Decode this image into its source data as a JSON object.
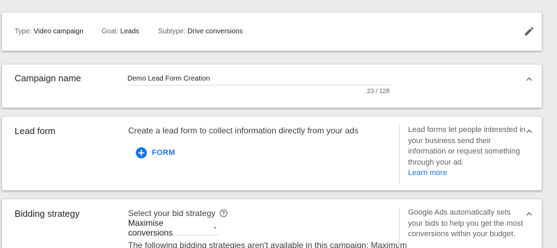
{
  "summary": {
    "type_label": "Type:",
    "type_value": "Video campaign",
    "goal_label": "Goal:",
    "goal_value": "Leads",
    "subtype_label": "Subtype:",
    "subtype_value": "Drive conversions",
    "edit_icon": "pencil-icon"
  },
  "campaign_name": {
    "title": "Campaign name",
    "value": "Demo Lead Form Creation",
    "counter": "23 / 128",
    "collapse_icon": "chevron-up-icon"
  },
  "lead_form": {
    "title": "Lead form",
    "description": "Create a lead form to collect information directly from your ads",
    "add_button": "FORM",
    "help_text": "Lead forms let people interested in your business send their information or request something through your ad.",
    "learn_more": "Learn more",
    "collapse_icon": "chevron-up-icon"
  },
  "bidding": {
    "title": "Bidding strategy",
    "prompt": "Select your bid strategy",
    "selected": "Maximise conversions",
    "note": "The following bidding strategies aren't available in this campaign: Maximum",
    "help_text": "Google Ads automatically sets your bids to help you get the most conversions within your budget.",
    "collapse_icon": "chevron-up-icon"
  },
  "colors": {
    "accent": "#1a73e8",
    "background": "#ebebeb",
    "divider": "#dadce0"
  }
}
